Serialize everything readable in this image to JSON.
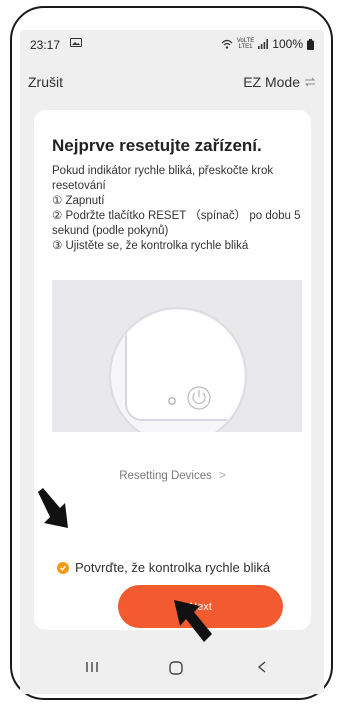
{
  "status": {
    "time": "23:17",
    "network_top": "VoLTE",
    "network_bottom": "LTE1",
    "battery": "100%"
  },
  "topbar": {
    "cancel_label": "Zrušit",
    "mode_label": "EZ Mode"
  },
  "card": {
    "title": "Nejprve resetujte zařízení.",
    "intro": "Pokud indikátor rychle bliká, přeskočte krok resetování",
    "steps": [
      "① Zapnutí",
      "② Podržte tlačítko RESET （spínač） po dobu 5 sekund (podle pokynů)",
      "③ Ujistěte se, že kontrolka rychle bliká"
    ],
    "link_label": "Resetting Devices",
    "link_chevron": ">"
  },
  "confirm": {
    "label": "Potvrďte, že kontrolka rychle bliká",
    "checked": true
  },
  "next_button": {
    "label": "Next"
  },
  "colors": {
    "accent": "#f25a2f",
    "check": "#f39c12",
    "background": "#efefef"
  },
  "icons": [
    "picture-icon",
    "wifi-icon",
    "signal-icon",
    "battery-icon",
    "swap-icon",
    "power-icon",
    "checkmark-icon",
    "recent-apps-icon",
    "home-icon",
    "back-icon",
    "arrow-icon"
  ]
}
